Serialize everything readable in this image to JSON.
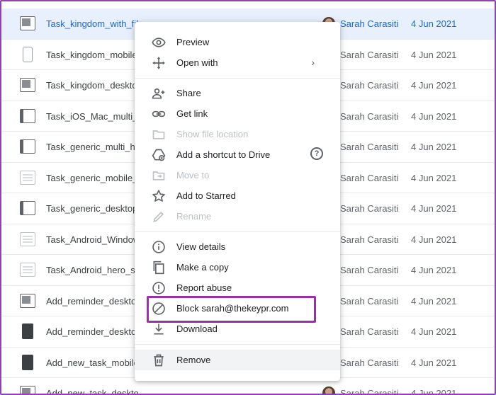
{
  "files": [
    {
      "name": "Task_kingdom_with_filters_desktop.jpg",
      "owner": "Sarah Carasiti",
      "modified": "4 Jun 2021",
      "thumb": "dark",
      "selected": true
    },
    {
      "name": "Task_kingdom_mobile.jpg",
      "owner": "Sarah Carasiti",
      "modified": "4 Jun 2021",
      "thumb": "phone"
    },
    {
      "name": "Task_kingdom_desktop.jpg",
      "owner": "Sarah Carasiti",
      "modified": "4 Jun 2021",
      "thumb": "dark"
    },
    {
      "name": "Task_iOS_Mac_multi_hero.jpg",
      "owner": "Sarah Carasiti",
      "modified": "4 Jun 2021",
      "thumb": "desk"
    },
    {
      "name": "Task_generic_multi_hero.jpg",
      "owner": "Sarah Carasiti",
      "modified": "4 Jun 2021",
      "thumb": "desk"
    },
    {
      "name": "Task_generic_mobile_hero.jpg",
      "owner": "Sarah Carasiti",
      "modified": "4 Jun 2021",
      "thumb": "light"
    },
    {
      "name": "Task_generic_desktop_hero.jpg",
      "owner": "Sarah Carasiti",
      "modified": "4 Jun 2021",
      "thumb": "desk"
    },
    {
      "name": "Task_Android_Windows_hero.jpg",
      "owner": "Sarah Carasiti",
      "modified": "4 Jun 2021",
      "thumb": "light"
    },
    {
      "name": "Task_Android_hero_screen.jpg",
      "owner": "Sarah Carasiti",
      "modified": "4 Jun 2021",
      "thumb": "light"
    },
    {
      "name": "Add_reminder_desktop.jpg",
      "owner": "Sarah Carasiti",
      "modified": "4 Jun 2021",
      "thumb": "dark"
    },
    {
      "name": "Add_reminder_desktop-1.jpg",
      "owner": "Sarah Carasiti",
      "modified": "4 Jun 2021",
      "thumb": "black"
    },
    {
      "name": "Add_new_task_mobile.jpg",
      "owner": "Sarah Carasiti",
      "modified": "4 Jun 2021",
      "thumb": "black"
    },
    {
      "name": "Add_new_task_desktop.jpg",
      "owner": "Sarah Carasiti",
      "modified": "4 Jun 2021",
      "thumb": "dark"
    }
  ],
  "menu": {
    "preview": "Preview",
    "open_with": "Open with",
    "share": "Share",
    "get_link": "Get link",
    "show_file_location": "Show file location",
    "add_shortcut": "Add a shortcut to Drive",
    "move_to": "Move to",
    "add_starred": "Add to Starred",
    "rename": "Rename",
    "view_details": "View details",
    "make_copy": "Make a copy",
    "report_abuse": "Report abuse",
    "block": "Block sarah@thekeypr.com",
    "download": "Download",
    "remove": "Remove",
    "chevron": "›",
    "help": "?"
  },
  "colors": {
    "selected_row": "#e8f0fe",
    "highlight_border": "#9b2fae",
    "frame": "#8e44ad"
  }
}
